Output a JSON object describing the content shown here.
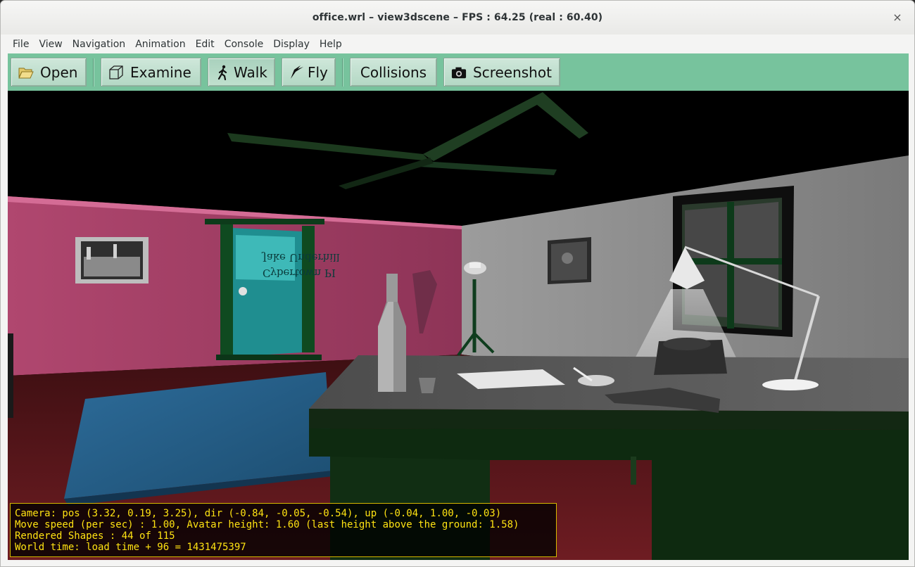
{
  "window": {
    "title": "office.wrl – view3dscene – FPS : 64.25 (real : 60.40)",
    "close_glyph": "×"
  },
  "menubar": {
    "items": [
      "File",
      "View",
      "Navigation",
      "Animation",
      "Edit",
      "Console",
      "Display",
      "Help"
    ]
  },
  "toolbar": {
    "open": {
      "label": "Open",
      "icon": "folder-open-icon"
    },
    "examine": {
      "label": "Examine",
      "icon": "cube-icon"
    },
    "walk": {
      "label": "Walk",
      "icon": "walking-person-icon"
    },
    "fly": {
      "label": "Fly",
      "icon": "bird-icon"
    },
    "collisions": {
      "label": "Collisions"
    },
    "screenshot": {
      "label": "Screenshot",
      "icon": "camera-icon"
    }
  },
  "scene": {
    "door_sign_line1": "Jake Underhill",
    "door_sign_line2": "Cybertown PI"
  },
  "hud": {
    "camera": "Camera: pos (3.32, 0.19, 3.25), dir (-0.84, -0.05, -0.54), up (-0.04, 1.00, -0.03)",
    "move_speed": "Move speed (per sec) : 1.00, Avatar height: 1.60 (last height above the ground: 1.58)",
    "rendered_shapes": "Rendered Shapes : 44 of 115",
    "world_time": "World time: load time + 96 = 1431475397"
  },
  "colors": {
    "toolbar_bg": "#77c39d",
    "hud_text": "#ffe312",
    "hud_border": "#d6b800"
  }
}
